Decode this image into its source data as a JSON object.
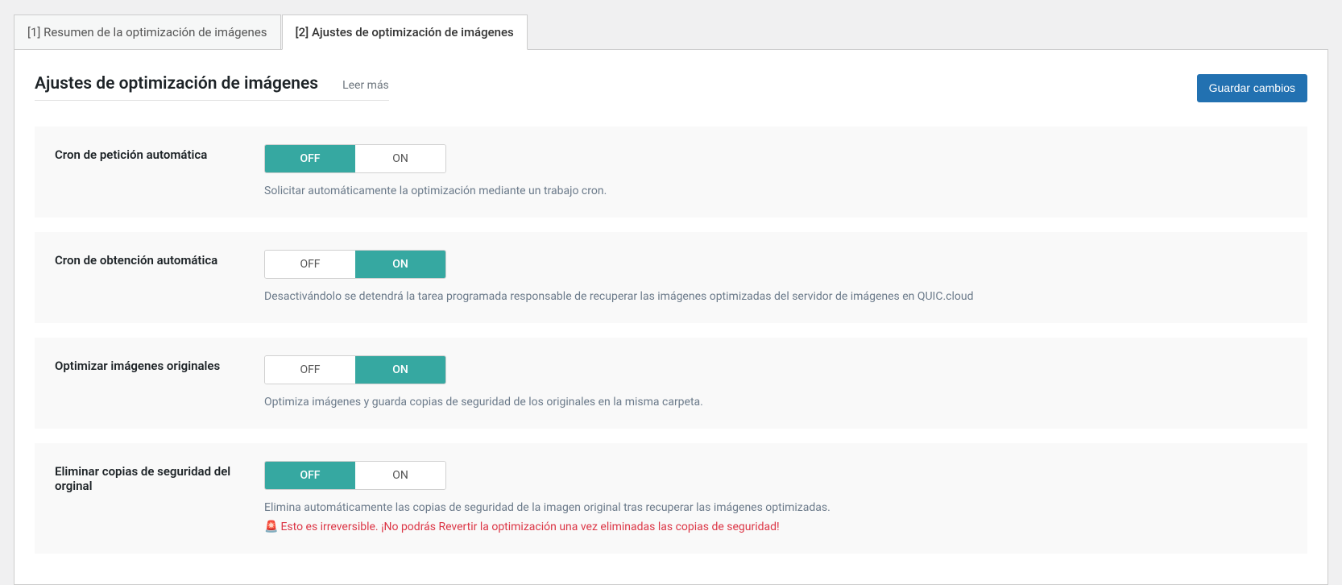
{
  "tabs": [
    {
      "label": "[1] Resumen de la optimización de imágenes"
    },
    {
      "label": "[2] Ajustes de optimización de imágenes"
    }
  ],
  "page_title": "Ajustes de optimización de imágenes",
  "read_more": "Leer más",
  "save_button": "Guardar cambios",
  "toggle_off": "OFF",
  "toggle_on": "ON",
  "settings": [
    {
      "label": "Cron de petición automática",
      "value": "OFF",
      "description": "Solicitar automáticamente la optimización mediante un trabajo cron."
    },
    {
      "label": "Cron de obtención automática",
      "value": "ON",
      "description": "Desactivándolo se detendrá la tarea programada responsable de recuperar las imágenes optimizadas del servidor de imágenes en QUIC.cloud"
    },
    {
      "label": "Optimizar imágenes originales",
      "value": "ON",
      "description": "Optimiza imágenes y guarda copias de seguridad de los originales en la misma carpeta."
    },
    {
      "label": "Eliminar copias de seguridad del orginal",
      "value": "OFF",
      "description": "Elimina automáticamente las copias de seguridad de la imagen original tras recuperar las imágenes optimizadas.",
      "warning_icon": "🚨",
      "warning": "Esto es irreversible. ¡No podrás Revertir la optimización una vez eliminadas las copias de seguridad!"
    }
  ]
}
